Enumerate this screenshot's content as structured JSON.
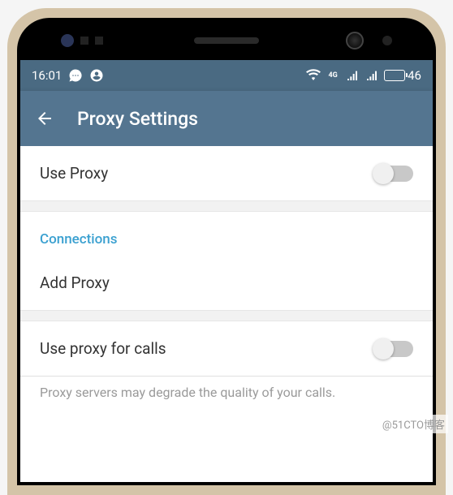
{
  "status_bar": {
    "time": "16:01",
    "battery_level": "46"
  },
  "app_bar": {
    "title": "Proxy Settings"
  },
  "settings": {
    "use_proxy_label": "Use Proxy",
    "connections_header": "Connections",
    "add_proxy_label": "Add Proxy",
    "use_proxy_calls_label": "Use proxy for calls",
    "hint": "Proxy servers may degrade the quality of your calls."
  },
  "watermark": "@51CTO博客"
}
